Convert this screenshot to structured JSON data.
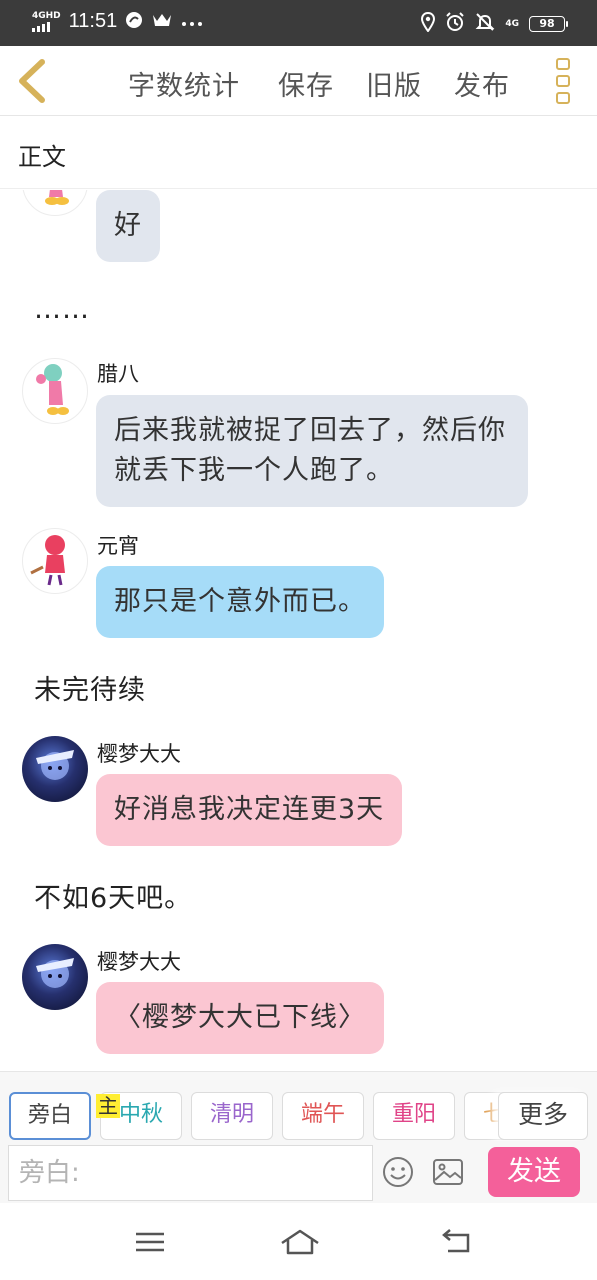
{
  "status_bar": {
    "network": "4GHD",
    "time": "11:51",
    "battery": "98",
    "right_network": "4G",
    "icons": [
      "chat-bubble-icon",
      "crown-icon",
      "more-dots-icon",
      "location-icon",
      "alarm-icon",
      "bell-muted-icon",
      "battery-icon"
    ]
  },
  "toolbar": {
    "word_count": "字数统计",
    "save": "保存",
    "old_version": "旧版",
    "publish": "发布",
    "icons": [
      "back-arrow-icon",
      "menu-dots-icon"
    ]
  },
  "section": {
    "title": "正文"
  },
  "messages": [
    {
      "type": "bubble",
      "speaker": "",
      "text": "好",
      "color": "grey"
    },
    {
      "type": "narration",
      "text": "……"
    },
    {
      "type": "bubble",
      "speaker": "腊八",
      "text": "后来我就被捉了回去了，然后你就丢下我一个人跑了。",
      "color": "grey"
    },
    {
      "type": "bubble",
      "speaker": "元宵",
      "text": "那只是个意外而已。",
      "color": "blue"
    },
    {
      "type": "narration",
      "text": "未完待续"
    },
    {
      "type": "bubble",
      "speaker": "樱梦大大",
      "text": "好消息我决定连更3天",
      "color": "pink"
    },
    {
      "type": "narration",
      "text": "不如6天吧。"
    },
    {
      "type": "bubble",
      "speaker": "樱梦大大",
      "text": "〈樱梦大大已下线〉",
      "color": "pink"
    }
  ],
  "quick_tags": {
    "main_tag": "主",
    "chips": [
      {
        "label": "旁白",
        "color": "#444444"
      },
      {
        "label": "中秋",
        "color": "#2aa8b0"
      },
      {
        "label": "清明",
        "color": "#9a66cc"
      },
      {
        "label": "端午",
        "color": "#e05555"
      },
      {
        "label": "重阳",
        "color": "#e04488"
      },
      {
        "label": "七",
        "color": "#e0a055"
      }
    ],
    "more": "更多"
  },
  "input_bar": {
    "placeholder": "旁白:",
    "send": "发送",
    "icons": [
      "emoji-icon",
      "image-icon"
    ]
  },
  "nav_bar": {
    "icons": [
      "menu-icon",
      "home-icon",
      "back-icon"
    ]
  },
  "colors": {
    "accent": "#d6b25a",
    "send": "#f4609a",
    "bubble_grey": "#e1e6ee",
    "bubble_blue": "#a6dcf8",
    "bubble_pink": "#fbc6d2"
  }
}
